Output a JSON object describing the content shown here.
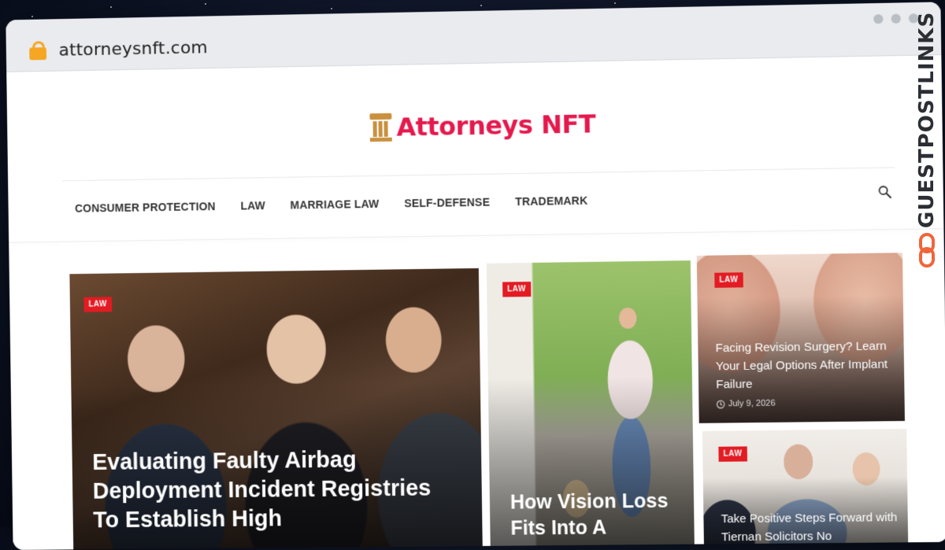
{
  "browser": {
    "url": "attorneysnft.com"
  },
  "site": {
    "logo_text": "Attorneys NFT",
    "nav": [
      "CONSUMER PROTECTION",
      "LAW",
      "MARRIAGE LAW",
      "SELF-DEFENSE",
      "TRADEMARK"
    ]
  },
  "articles": [
    {
      "badge": "LAW",
      "title": "Evaluating Faulty Airbag Deployment Incident Registries To Establish High"
    },
    {
      "badge": "LAW",
      "title": "How Vision Loss Fits Into A"
    },
    {
      "badge": "LAW",
      "title": "Facing Revision Surgery? Learn Your Legal Options After Implant Failure",
      "date": "July 9, 2026"
    },
    {
      "badge": "LAW",
      "title": "Take Positive Steps Forward with Tiernan Solicitors No"
    }
  ],
  "watermark": {
    "text": "GUESTPOSTLINKS"
  },
  "colors": {
    "accent": "#e5194d",
    "badge": "#e31b23",
    "gold": "#c9913f"
  }
}
